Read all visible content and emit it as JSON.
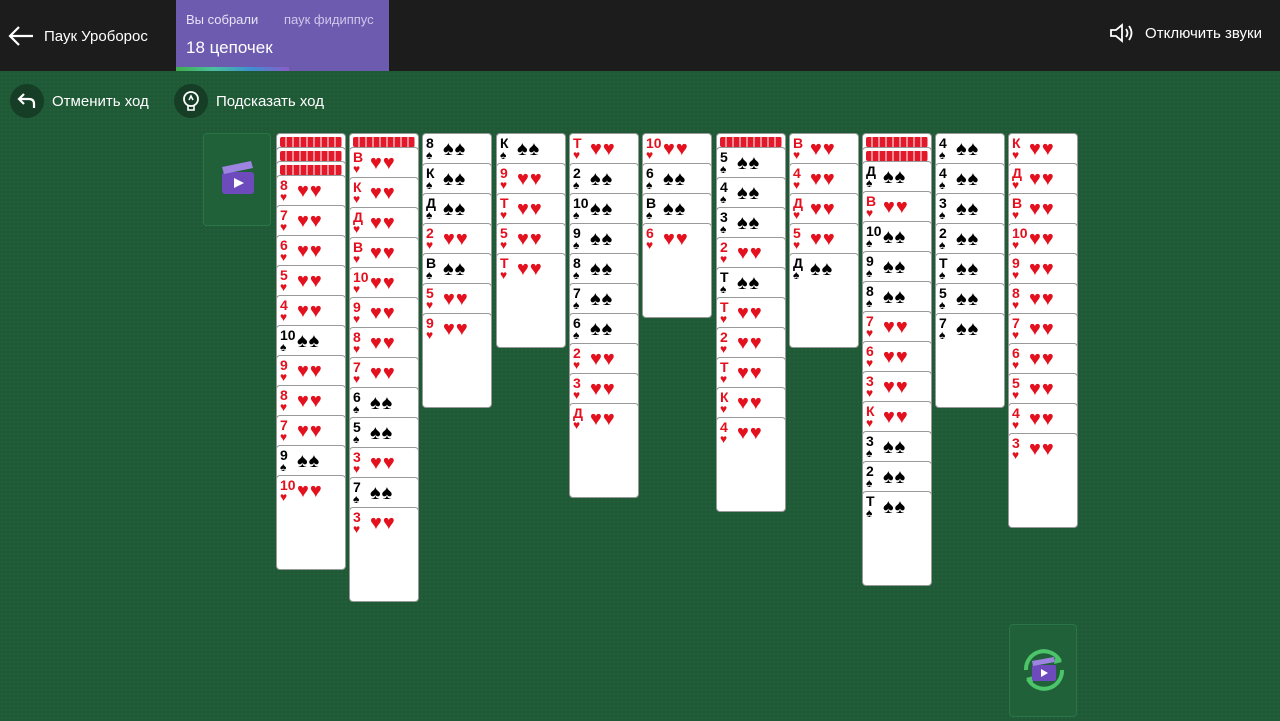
{
  "header": {
    "back_label": "Паук Уроборос",
    "collected_label": "Вы собрали",
    "game_name": "паук фидиппус",
    "chains_text": "18 цепочек",
    "sound_label": "Отключить звуки"
  },
  "actions": {
    "undo_label": "Отменить ход",
    "hint_label": "Подсказать ход"
  },
  "colors": {
    "felt": "#1f5a36",
    "topbar": "#1c1c1c",
    "score_panel": "#6d5bb0",
    "red_suit": "#e3101e"
  },
  "columns": [
    {
      "hidden": 3,
      "cards": [
        [
          "8",
          "♥"
        ],
        [
          "7",
          "♥"
        ],
        [
          "6",
          "♥"
        ],
        [
          "5",
          "♥"
        ],
        [
          "4",
          "♥"
        ],
        [
          "10",
          "♠"
        ],
        [
          "9",
          "♥"
        ],
        [
          "8",
          "♥"
        ],
        [
          "7",
          "♥"
        ],
        [
          "9",
          "♠"
        ],
        [
          "10",
          "♥"
        ]
      ]
    },
    {
      "hidden": 1,
      "cards": [
        [
          "В",
          "♥"
        ],
        [
          "К",
          "♥"
        ],
        [
          "Д",
          "♥"
        ],
        [
          "В",
          "♥"
        ],
        [
          "10",
          "♥"
        ],
        [
          "9",
          "♥"
        ],
        [
          "8",
          "♥"
        ],
        [
          "7",
          "♥"
        ],
        [
          "6",
          "♠"
        ],
        [
          "5",
          "♠"
        ],
        [
          "3",
          "♥"
        ],
        [
          "7",
          "♠"
        ],
        [
          "3",
          "♥"
        ]
      ]
    },
    {
      "hidden": 0,
      "cards": [
        [
          "8",
          "♠"
        ],
        [
          "К",
          "♠"
        ],
        [
          "Д",
          "♠"
        ],
        [
          "2",
          "♥"
        ],
        [
          "В",
          "♠"
        ],
        [
          "5",
          "♥"
        ],
        [
          "9",
          "♥"
        ]
      ]
    },
    {
      "hidden": 0,
      "cards": [
        [
          "К",
          "♠"
        ],
        [
          "9",
          "♥"
        ],
        [
          "Т",
          "♥"
        ],
        [
          "5",
          "♥"
        ],
        [
          "Т",
          "♥"
        ]
      ]
    },
    {
      "hidden": 0,
      "cards": [
        [
          "Т",
          "♥"
        ],
        [
          "2",
          "♠"
        ],
        [
          "10",
          "♠"
        ],
        [
          "9",
          "♠"
        ],
        [
          "8",
          "♠"
        ],
        [
          "7",
          "♠"
        ],
        [
          "6",
          "♠"
        ],
        [
          "2",
          "♥"
        ],
        [
          "3",
          "♥"
        ],
        [
          "Д",
          "♥"
        ]
      ]
    },
    {
      "hidden": 0,
      "cards": [
        [
          "10",
          "♥"
        ],
        [
          "6",
          "♠"
        ],
        [
          "В",
          "♠"
        ],
        [
          "6",
          "♥"
        ]
      ]
    },
    {
      "hidden": 1,
      "cards": [
        [
          "5",
          "♠"
        ],
        [
          "4",
          "♠"
        ],
        [
          "3",
          "♠"
        ],
        [
          "2",
          "♥"
        ],
        [
          "Т",
          "♠"
        ],
        [
          "Т",
          "♥"
        ],
        [
          "2",
          "♥"
        ],
        [
          "Т",
          "♥"
        ],
        [
          "К",
          "♥"
        ],
        [
          "4",
          "♥"
        ]
      ]
    },
    {
      "hidden": 0,
      "cards": [
        [
          "В",
          "♥"
        ],
        [
          "4",
          "♥"
        ],
        [
          "Д",
          "♥"
        ],
        [
          "5",
          "♥"
        ],
        [
          "Д",
          "♠"
        ]
      ]
    },
    {
      "hidden": 2,
      "cards": [
        [
          "Д",
          "♠"
        ],
        [
          "В",
          "♥"
        ],
        [
          "10",
          "♠"
        ],
        [
          "9",
          "♠"
        ],
        [
          "8",
          "♠"
        ],
        [
          "7",
          "♥"
        ],
        [
          "6",
          "♥"
        ],
        [
          "3",
          "♥"
        ],
        [
          "К",
          "♥"
        ],
        [
          "3",
          "♠"
        ],
        [
          "2",
          "♠"
        ],
        [
          "Т",
          "♠"
        ]
      ]
    },
    {
      "hidden": 0,
      "cards": [
        [
          "4",
          "♠"
        ],
        [
          "4",
          "♠"
        ],
        [
          "3",
          "♠"
        ],
        [
          "2",
          "♠"
        ],
        [
          "Т",
          "♠"
        ],
        [
          "5",
          "♠"
        ],
        [
          "7",
          "♠"
        ]
      ]
    },
    {
      "hidden": 0,
      "cards": [
        [
          "К",
          "♥"
        ],
        [
          "Д",
          "♥"
        ],
        [
          "В",
          "♥"
        ],
        [
          "10",
          "♥"
        ],
        [
          "9",
          "♥"
        ],
        [
          "8",
          "♥"
        ],
        [
          "7",
          "♥"
        ],
        [
          "6",
          "♥"
        ],
        [
          "5",
          "♥"
        ],
        [
          "4",
          "♥"
        ],
        [
          "3",
          "♥"
        ]
      ]
    }
  ]
}
